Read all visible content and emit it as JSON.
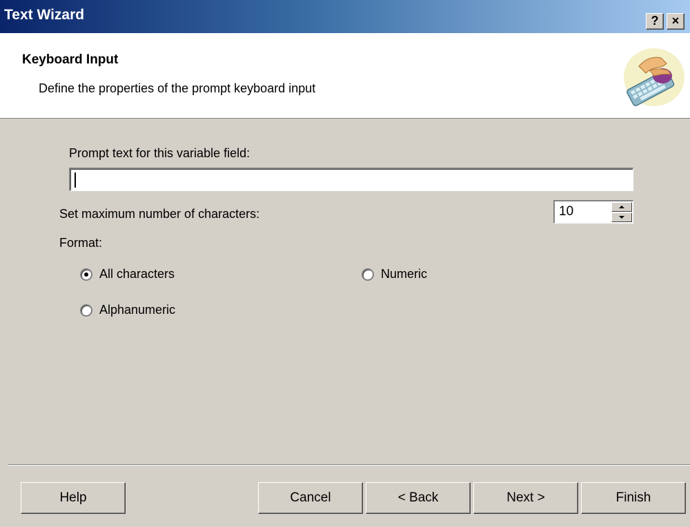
{
  "window": {
    "title": "Text Wizard",
    "help_btn": "?",
    "close_btn": "×"
  },
  "header": {
    "title": "Keyboard Input",
    "subtitle": "Define the properties of the prompt keyboard input",
    "icon": "keyboard-hand-icon"
  },
  "form": {
    "prompt_label": "Prompt text for this variable field:",
    "prompt_value": "",
    "max_chars_label": "Set maximum number of characters:",
    "max_chars_value": "10",
    "format_label": "Format:",
    "options": {
      "all": "All characters",
      "numeric": "Numeric",
      "alnum": "Alphanumeric"
    },
    "selected": "All characters"
  },
  "buttons": {
    "help": "Help",
    "cancel": "Cancel",
    "back": "< Back",
    "next": "Next >",
    "finish": "Finish"
  }
}
